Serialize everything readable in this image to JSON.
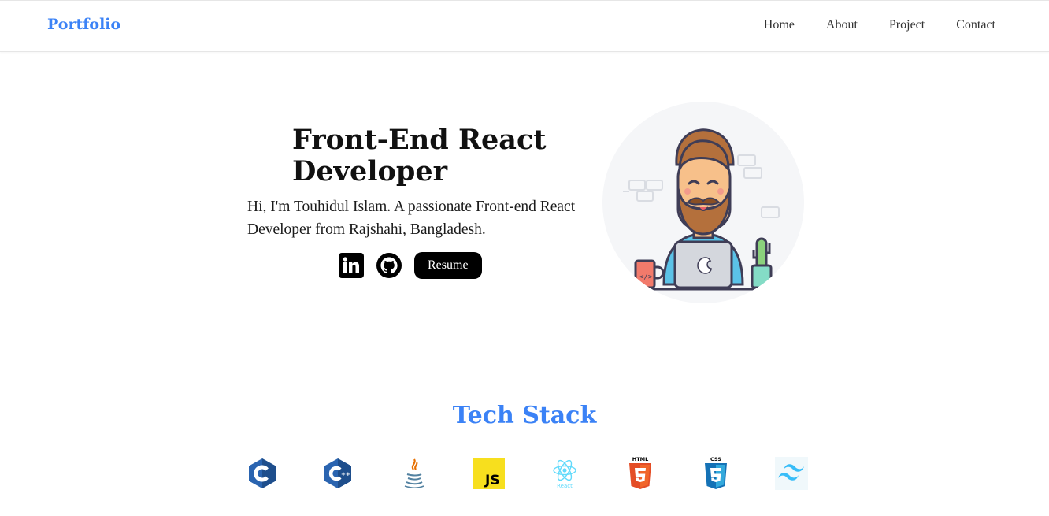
{
  "navbar": {
    "brand": "Portfolio",
    "links": [
      "Home",
      "About",
      "Project",
      "Contact"
    ]
  },
  "hero": {
    "title": "Front-End React Developer",
    "description": "Hi, I'm Touhidul Islam. A passionate Front-end React Developer from Rajshahi, Bangladesh.",
    "resume_label": "Resume",
    "socials": [
      "linkedin-icon",
      "github-icon"
    ]
  },
  "tech_stack": {
    "title": "Tech Stack",
    "icons": [
      "c-icon",
      "cpp-icon",
      "java-icon",
      "javascript-icon",
      "react-icon",
      "html5-icon",
      "css3-icon",
      "tailwind-icon"
    ],
    "react_caption": "React",
    "html_caption": "HTML",
    "css_caption": "CSS",
    "js_caption": "JS"
  },
  "colors": {
    "accent": "#3b82f6",
    "button_bg": "#000000",
    "avatar_bg": "#f5f6f8"
  }
}
